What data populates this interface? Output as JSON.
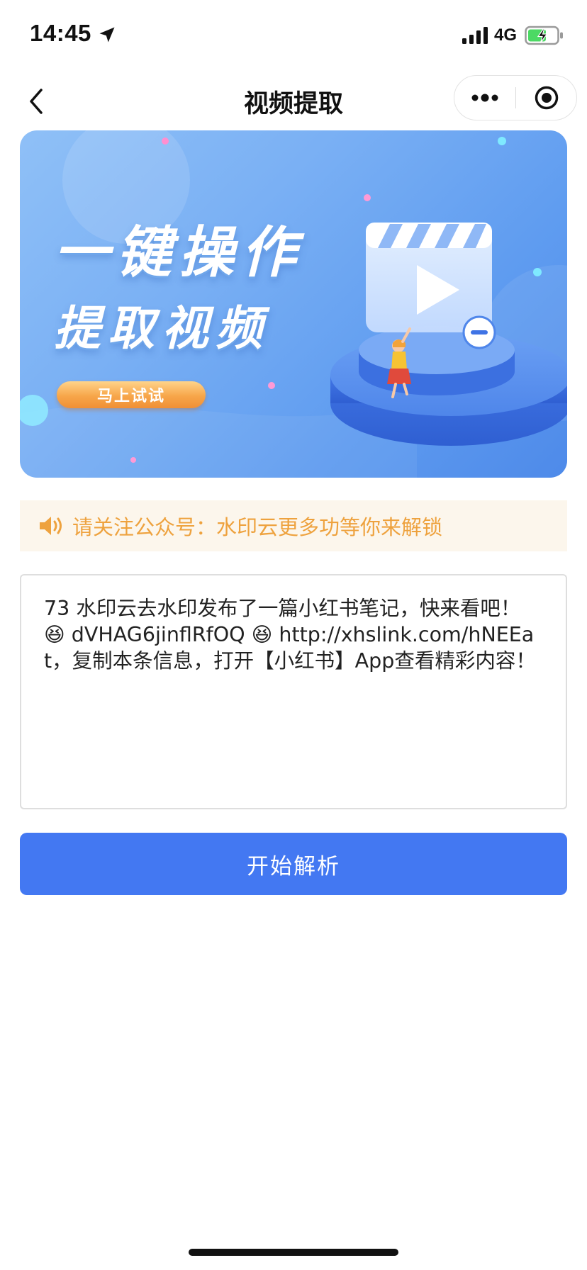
{
  "status_bar": {
    "time": "14:45",
    "network": "4G",
    "location_icon": "location-arrow-icon",
    "signal_icon": "cellular-signal-icon",
    "battery_icon": "battery-charging-icon",
    "battery_color": "#4cd964"
  },
  "nav": {
    "title": "视频提取",
    "back_icon": "chevron-left-icon",
    "more_icon": "more-dots-icon",
    "close_icon": "miniprogram-close-icon"
  },
  "banner": {
    "headline_line1": "一键操作",
    "headline_line2": "提取视频",
    "button_label": "马上试试",
    "illustration": "video-clapperboard-play-icon"
  },
  "notice": {
    "icon": "speaker-icon",
    "text": "请关注公众号：水印云更多功等你来解锁",
    "color": "#eea23e"
  },
  "input": {
    "value": "73 水印云去水印发布了一篇小红书笔记，快来看吧！ 😆 dVHAG6jinflRfOQ 😆 http://xhslink.com/hNEEat，复制本条信息，打开【小红书】App查看精彩内容！"
  },
  "actions": {
    "parse_label": "开始解析",
    "accent_color": "#4378f2"
  }
}
